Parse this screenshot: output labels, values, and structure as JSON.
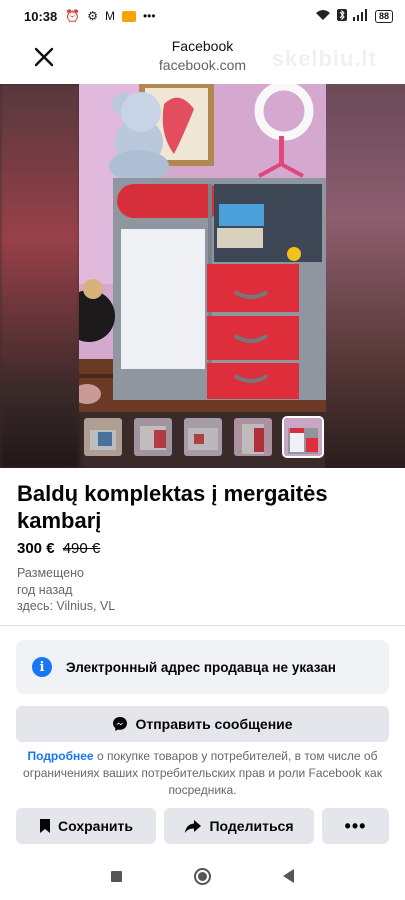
{
  "status_bar": {
    "time": "10:38",
    "left_icons": [
      "alarm-icon",
      "gear-icon",
      "gmail-icon",
      "app-notification-icon",
      "more-dots-icon"
    ],
    "right_icons": [
      "wifi-icon",
      "bluetooth-icon",
      "signal-icon"
    ],
    "battery": "88"
  },
  "browser": {
    "title": "Facebook",
    "url": "facebook.com",
    "watermark": "skelbiu.lt"
  },
  "photos": {
    "thumbnail_count": 5,
    "active_index": 4
  },
  "listing": {
    "title": "Baldų komplektas į mergaitės kambarį",
    "price": "300 €",
    "old_price": "490 €",
    "posted_label": "Размещено",
    "posted_time": "год назад",
    "location": "здесь: Vilnius, VL"
  },
  "info_box": {
    "text": "Электронный адрес продавца не указан"
  },
  "message_button": {
    "label": "Отправить сообщение"
  },
  "disclaimer": {
    "link": "Подробнее",
    "text": " о покупке товаров у потребителей, в том числе об ограничениях ваших потребительских прав и роли Facebook как посредника."
  },
  "actions": {
    "save": "Сохранить",
    "share": "Поделиться",
    "more": "•••"
  },
  "colors": {
    "accent": "#1877f2",
    "button_bg": "#e4e6eb",
    "info_bg": "#f0f2f5"
  }
}
